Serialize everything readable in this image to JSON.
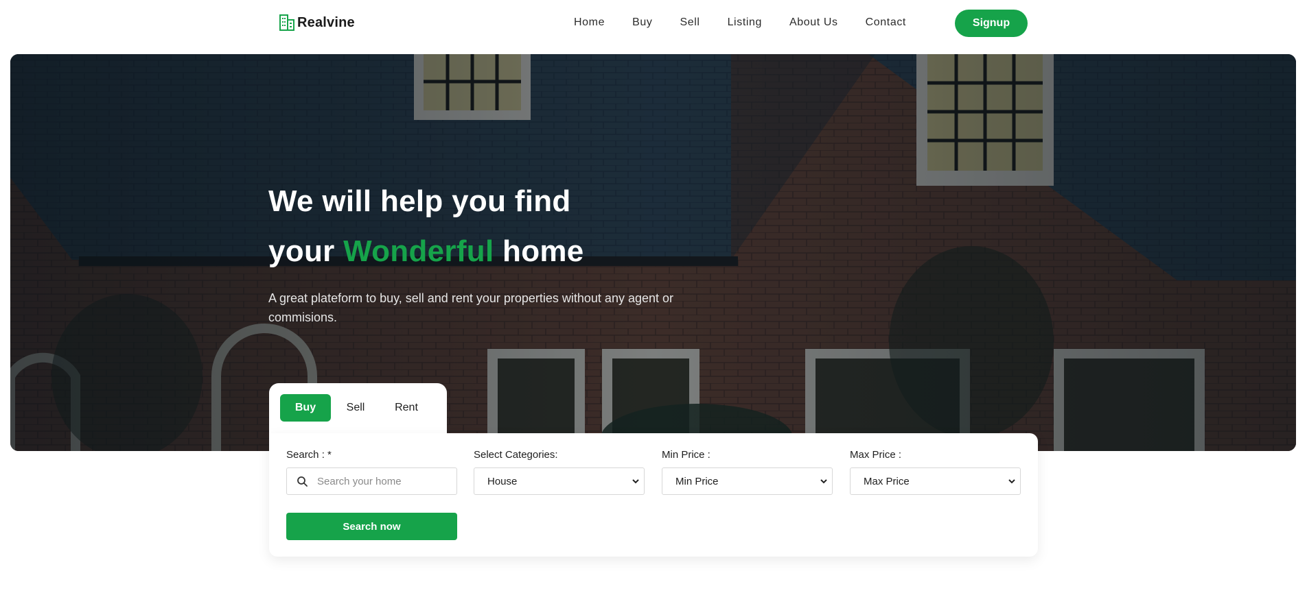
{
  "brand": {
    "name": "Realvine",
    "accent_color": "#16a34a",
    "icon": "building-icon"
  },
  "nav": {
    "links": [
      "Home",
      "Buy",
      "Sell",
      "Listing",
      "About Us",
      "Contact"
    ],
    "signup_label": "Signup"
  },
  "hero": {
    "title_line1": "We will help you find",
    "title_line2_prefix": "your ",
    "title_line2_accent": "Wonderful",
    "title_line2_suffix": " home",
    "subtitle": "A great plateform to buy, sell and rent your properties without any agent or commisions."
  },
  "tabs": {
    "items": [
      "Buy",
      "Sell",
      "Rent"
    ],
    "active": "Buy"
  },
  "search": {
    "search_label": "Search : *",
    "search_placeholder": "Search your home",
    "categories_label": "Select Categories:",
    "categories_value": "House",
    "min_price_label": "Min Price :",
    "min_price_value": "Min Price",
    "max_price_label": "Max Price :",
    "max_price_value": "Max Price",
    "button_label": "Search now"
  }
}
